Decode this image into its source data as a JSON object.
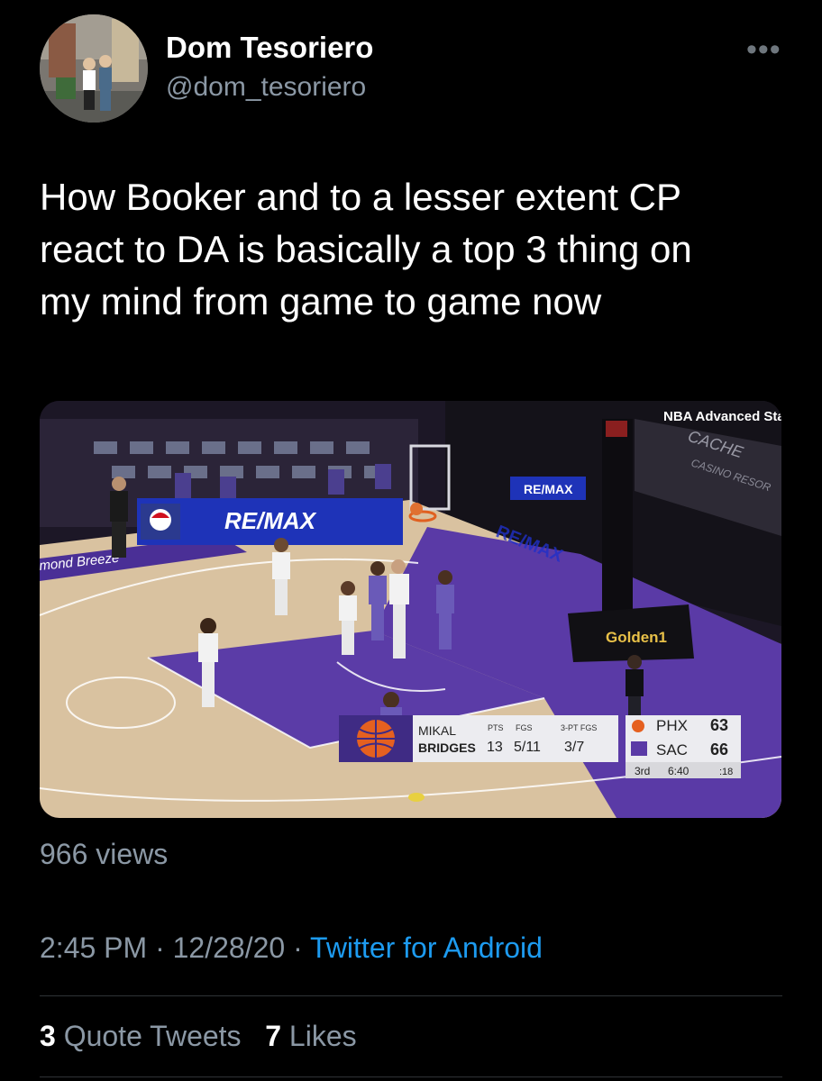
{
  "author": {
    "display_name": "Dom Tesoriero",
    "handle": "@dom_tesoriero"
  },
  "more_icon": "more-horizontal-icon",
  "tweet": {
    "text": "How Booker and to a lesser extent CP\nreact to DA is basically a top 3 thing on\nmy mind from game to game now"
  },
  "media": {
    "watermark": "NBA Advanced Stats",
    "court_signs": {
      "remax_left": "RE/MAX",
      "remax_small": "RE/MAX",
      "remax_slanted": "RE/MAX",
      "golden1": "Golden1",
      "cache_creek": "CACHE",
      "casino": "CASINO RESOR",
      "diamond": "mond Breeze"
    },
    "player_card": {
      "first_name": "MIKAL",
      "last_name": "BRIDGES",
      "headers": [
        "PTS",
        "FGS",
        "3-PT FGS"
      ],
      "values": [
        "13",
        "5/11",
        "3/7"
      ]
    },
    "score": {
      "team1": "PHX",
      "score1": "63",
      "team2": "SAC",
      "score2": "66",
      "period": "3rd",
      "clock": "6:40",
      "shot_clock": ":18"
    }
  },
  "views": "966 views",
  "timestamp": {
    "time": "2:45 PM",
    "sep1": " · ",
    "date": "12/28/20",
    "sep2": " · ",
    "source": "Twitter for Android"
  },
  "engagement": {
    "quote_count": "3",
    "quote_label": "Quote Tweets",
    "like_count": "7",
    "like_label": "Likes"
  }
}
